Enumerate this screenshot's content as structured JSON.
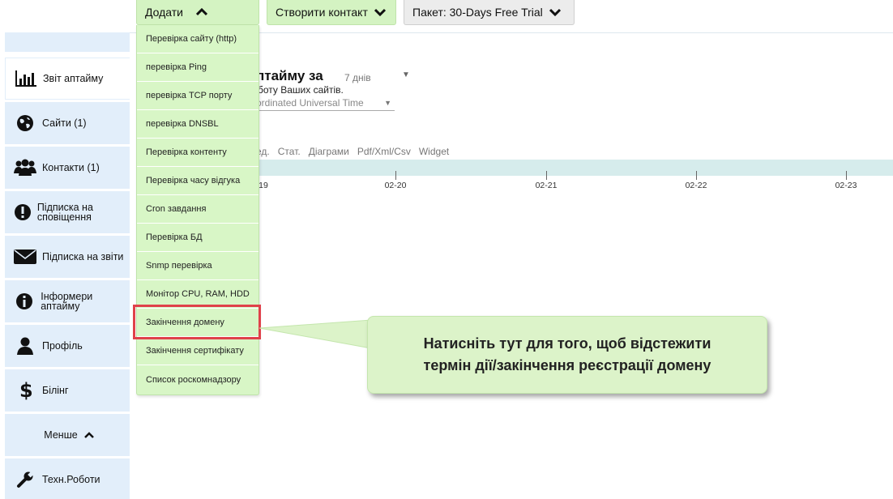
{
  "topbar": {
    "add_label": "Додати",
    "create_contact_label": "Створити контакт",
    "plan_label": "Пакет: 30-Days Free Trial"
  },
  "sidebar": {
    "items": [
      {
        "label": "Звіт аптайму",
        "icon": "bar-chart-icon",
        "active": true
      },
      {
        "label": "Сайти (1)",
        "icon": "globe-icon"
      },
      {
        "label": "Контакти (1)",
        "icon": "users-icon"
      },
      {
        "label": "Підписка на сповіщення",
        "icon": "exclamation-icon"
      },
      {
        "label": "Підписка на звіти",
        "icon": "envelope-icon"
      },
      {
        "label": "Інформери аптайму",
        "icon": "info-icon"
      },
      {
        "label": "Профіль",
        "icon": "user-icon"
      },
      {
        "label": "Білінг",
        "icon": "dollar-icon"
      },
      {
        "label": "Менше",
        "icon": "chevron-up-icon"
      },
      {
        "label": "Техн.Роботи",
        "icon": "wrench-icon"
      }
    ]
  },
  "main": {
    "title": "птайму за",
    "period": "7 днів",
    "subtitle": "боту Ваших сайтів.",
    "timezone": "ordinated Universal Time",
    "tabs": [
      "ед.",
      "Стат.",
      "Діаграми",
      "Pdf/Xml/Csv",
      "Widget"
    ],
    "timeline_labels": [
      "19",
      "02-20",
      "02-21",
      "02-22",
      "02-23"
    ]
  },
  "dropdown": {
    "items": [
      "Перевірка сайту (http)",
      "перевірка Ping",
      "перевірка TCP порту",
      "перевірка DNSBL",
      "Перевірка контенту",
      "Перевірка часу відгука",
      "Cron завдання",
      "Перевірка БД",
      "Snmp перевірка",
      "Монітор CPU, RAM, HDD",
      "Закінчення домену",
      "Закінчення сертифікату",
      "Список роскомнадзору"
    ]
  },
  "callout": {
    "text": "Натисніть тут для того, щоб відстежити термін дії/закінчення реєстрації домену"
  },
  "colors": {
    "green_button": "#d4f3c2",
    "sidebar_bg": "#e2eefa",
    "highlight": "#e0414a",
    "timeline": "#d6ecec"
  }
}
